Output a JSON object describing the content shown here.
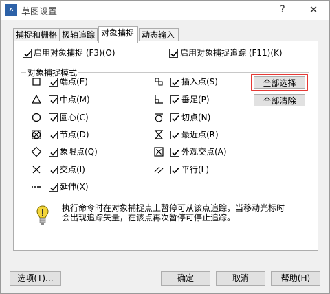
{
  "window": {
    "title": "草图设置",
    "help_glyph": "?",
    "close_glyph": "✕"
  },
  "tabs": [
    {
      "label": "捕捉和栅格",
      "active": false
    },
    {
      "label": "极轴追踪",
      "active": false
    },
    {
      "label": "对象捕捉",
      "active": true
    },
    {
      "label": "动态输入",
      "active": false
    }
  ],
  "snap_panel": {
    "enable_snap": {
      "label": "启用对象捕捉 (F3)(O)",
      "checked": true
    },
    "enable_tracking": {
      "label": "启用对象捕捉追踪 (F11)(K)",
      "checked": true
    },
    "modes_group_label": "对象捕捉模式",
    "modes_left": [
      {
        "label": "端点(E)",
        "checked": true,
        "icon": "endpoint-icon"
      },
      {
        "label": "中点(M)",
        "checked": true,
        "icon": "midpoint-icon"
      },
      {
        "label": "圆心(C)",
        "checked": true,
        "icon": "center-icon"
      },
      {
        "label": "节点(D)",
        "checked": true,
        "icon": "node-icon"
      },
      {
        "label": "象限点(Q)",
        "checked": true,
        "icon": "quadrant-icon"
      },
      {
        "label": "交点(I)",
        "checked": true,
        "icon": "intersection-icon"
      },
      {
        "label": "延伸(X)",
        "checked": true,
        "icon": "extension-icon"
      }
    ],
    "modes_right": [
      {
        "label": "插入点(S)",
        "checked": true,
        "icon": "insertion-icon"
      },
      {
        "label": "垂足(P)",
        "checked": true,
        "icon": "perpendicular-icon"
      },
      {
        "label": "切点(N)",
        "checked": true,
        "icon": "tangent-icon"
      },
      {
        "label": "最近点(R)",
        "checked": true,
        "icon": "nearest-icon"
      },
      {
        "label": "外观交点(A)",
        "checked": true,
        "icon": "apparent-intersection-icon"
      },
      {
        "label": "平行(L)",
        "checked": true,
        "icon": "parallel-icon"
      }
    ],
    "select_all_label": "全部选择",
    "clear_all_label": "全部清除",
    "tip_line1": "执行命令时在对象捕捉点上暂停可从该点追踪，当移动光标时",
    "tip_line2": "会出现追踪矢量，在该点再次暂停可停止追踪。"
  },
  "footer": {
    "options_label": "选项(T)...",
    "ok_label": "确定",
    "cancel_label": "取消",
    "help_label": "帮助(H)"
  },
  "colors": {
    "highlight": "#e53935",
    "tip_bulb": "#f3d53a"
  }
}
